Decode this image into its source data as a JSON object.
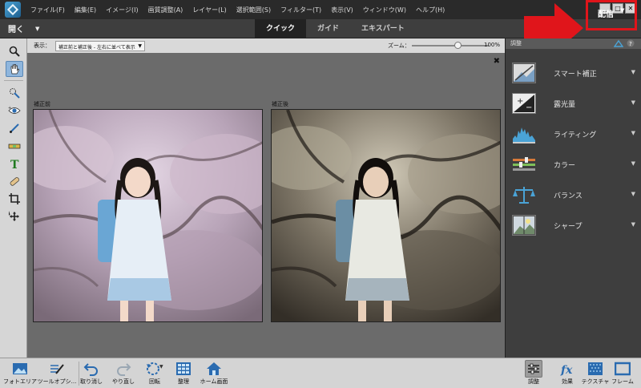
{
  "menubar": {
    "items": [
      "ファイル(F)",
      "編集(E)",
      "イメージ(I)",
      "画質調整(A)",
      "レイヤー(L)",
      "選択範囲(S)",
      "フィルター(T)",
      "表示(V)",
      "ウィンドウ(W)",
      "ヘルプ(H)"
    ],
    "window_controls": [
      "_",
      "□",
      "✕"
    ]
  },
  "modebar": {
    "open_label": "開く",
    "tabs": [
      {
        "label": "クイック",
        "active": true
      },
      {
        "label": "ガイド",
        "active": false
      },
      {
        "label": "エキスパート",
        "active": false
      }
    ],
    "share_label": "配信"
  },
  "options": {
    "view_label": "表示：",
    "view_value": "補正前と補正後 - 左右に並べて表示",
    "zoom_label": "ズーム：",
    "zoom_value": "100%",
    "zoom_fraction": 0.6
  },
  "canvas": {
    "before_label": "補正前",
    "after_label": "補正後",
    "close_glyph": "✖"
  },
  "panel": {
    "title": "調整",
    "items": [
      {
        "label": "スマート補正",
        "icon": "smart-fix-icon"
      },
      {
        "label": "露光量",
        "icon": "exposure-icon"
      },
      {
        "label": "ライティング",
        "icon": "lighting-icon"
      },
      {
        "label": "カラー",
        "icon": "color-icon"
      },
      {
        "label": "バランス",
        "icon": "balance-icon"
      },
      {
        "label": "シャープ",
        "icon": "sharpen-icon"
      }
    ]
  },
  "bottombar": {
    "items": [
      {
        "label": "フォトエリア"
      },
      {
        "label": "ツールオプシ..."
      },
      {
        "label": "取り消し"
      },
      {
        "label": "やり直し"
      },
      {
        "label": "回転"
      },
      {
        "label": "整理"
      },
      {
        "label": "ホーム画面"
      },
      {
        "label": "調整"
      },
      {
        "label": "効果"
      },
      {
        "label": "テクスチャ"
      },
      {
        "label": "フレーム"
      }
    ]
  },
  "colors": {
    "highlight_red": "#e0151b",
    "active_tool": "#8fb6dd"
  }
}
